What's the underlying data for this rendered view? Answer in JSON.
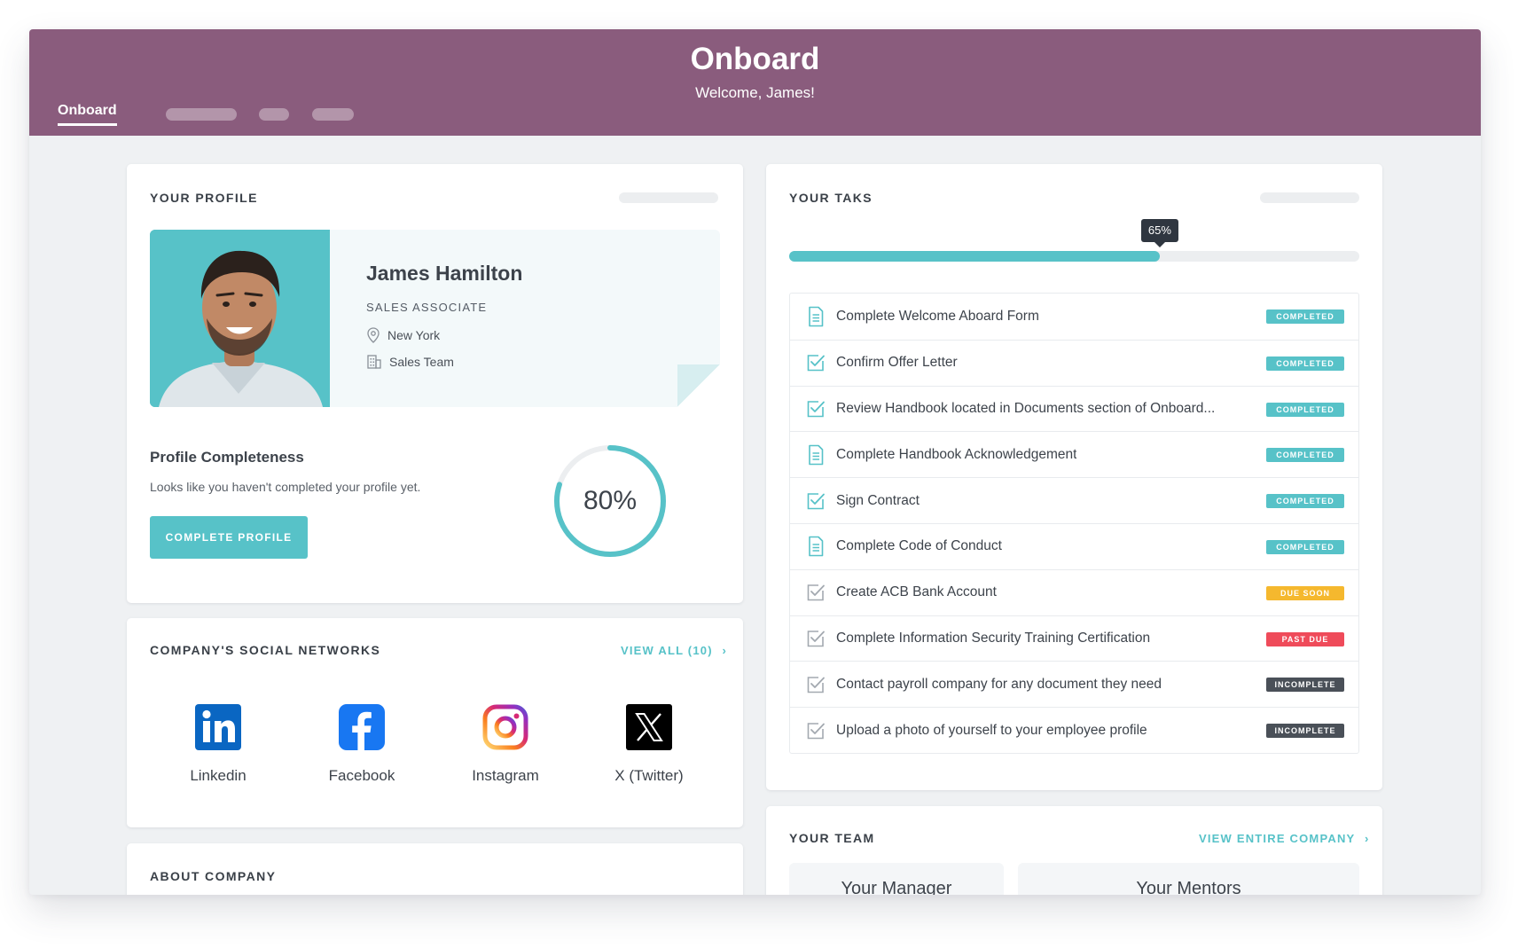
{
  "app": {
    "title": "Onboard",
    "welcome": "Welcome, James!"
  },
  "nav": {
    "active_tab": "Onboard"
  },
  "profile": {
    "section_title": "YOUR PROFILE",
    "name": "James Hamilton",
    "role": "SALES ASSOCIATE",
    "location": "New York",
    "team": "Sales Team",
    "completeness_title": "Profile Completeness",
    "completeness_text": "Looks like you haven't completed your profile yet.",
    "complete_button": "COMPLETE PROFILE",
    "completeness_percent": 80,
    "completeness_label": "80%"
  },
  "social": {
    "section_title": "COMPANY'S SOCIAL NETWORKS",
    "view_all": "VIEW ALL (10)",
    "networks": [
      {
        "label": "Linkedin",
        "icon": "linkedin-icon"
      },
      {
        "label": "Facebook",
        "icon": "facebook-icon"
      },
      {
        "label": "Instagram",
        "icon": "instagram-icon"
      },
      {
        "label": "X (Twitter)",
        "icon": "x-twitter-icon"
      }
    ]
  },
  "about": {
    "section_title": "ABOUT COMPANY"
  },
  "tasks": {
    "section_title": "YOUR TAKS",
    "progress_percent": 65,
    "progress_label": "65%",
    "items": [
      {
        "label": "Complete Welcome Aboard Form",
        "icon": "form-document-icon",
        "status": "COMPLETED",
        "status_color": "#57c2c8"
      },
      {
        "label": "Confirm Offer Letter",
        "icon": "checkbox-icon",
        "status": "COMPLETED",
        "status_color": "#57c2c8"
      },
      {
        "label": "Review Handbook located in Documents section of Onboard...",
        "icon": "checkbox-icon",
        "status": "COMPLETED",
        "status_color": "#57c2c8"
      },
      {
        "label": "Complete Handbook Acknowledgement",
        "icon": "form-document-icon",
        "status": "COMPLETED",
        "status_color": "#57c2c8"
      },
      {
        "label": "Sign Contract",
        "icon": "checkbox-icon",
        "status": "COMPLETED",
        "status_color": "#57c2c8"
      },
      {
        "label": "Complete Code of Conduct",
        "icon": "form-document-icon",
        "status": "COMPLETED",
        "status_color": "#57c2c8"
      },
      {
        "label": "Create ACB Bank Account",
        "icon": "checkbox-gray-icon",
        "status": "DUE SOON",
        "status_color": "#f5b82e"
      },
      {
        "label": "Complete Information Security Training Certification",
        "icon": "checkbox-gray-icon",
        "status": "PAST DUE",
        "status_color": "#ef4b5a"
      },
      {
        "label": "Contact payroll company for any document they need",
        "icon": "checkbox-gray-icon",
        "status": "INCOMPLETE",
        "status_color": "#4a5058"
      },
      {
        "label": "Upload a photo of yourself to your employee profile",
        "icon": "checkbox-gray-icon",
        "status": "INCOMPLETE",
        "status_color": "#4a5058"
      }
    ]
  },
  "team": {
    "section_title": "YOUR TEAM",
    "view_company": "VIEW ENTIRE COMPANY",
    "manager_title": "Your Manager",
    "mentors_title": "Your Mentors"
  },
  "colors": {
    "header": "#8a5c7d",
    "accent": "#57c2c8"
  }
}
